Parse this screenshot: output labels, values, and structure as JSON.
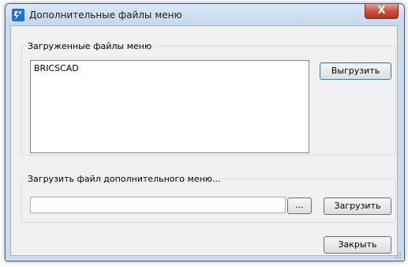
{
  "window": {
    "title": "Дополнительные файлы меню",
    "close_glyph": "X",
    "icon": "bricscad-app-icon",
    "accent": "#1e73c8"
  },
  "loaded_group": {
    "legend": "Загруженные файлы меню",
    "items": [
      "BRICSCAD"
    ],
    "unload_label": "Выгрузить"
  },
  "load_group": {
    "legend": "Загрузить файл дополнительного меню...",
    "path_value": "",
    "browse_label": "...",
    "load_label": "Загрузить"
  },
  "footer": {
    "close_label": "Закрыть"
  }
}
